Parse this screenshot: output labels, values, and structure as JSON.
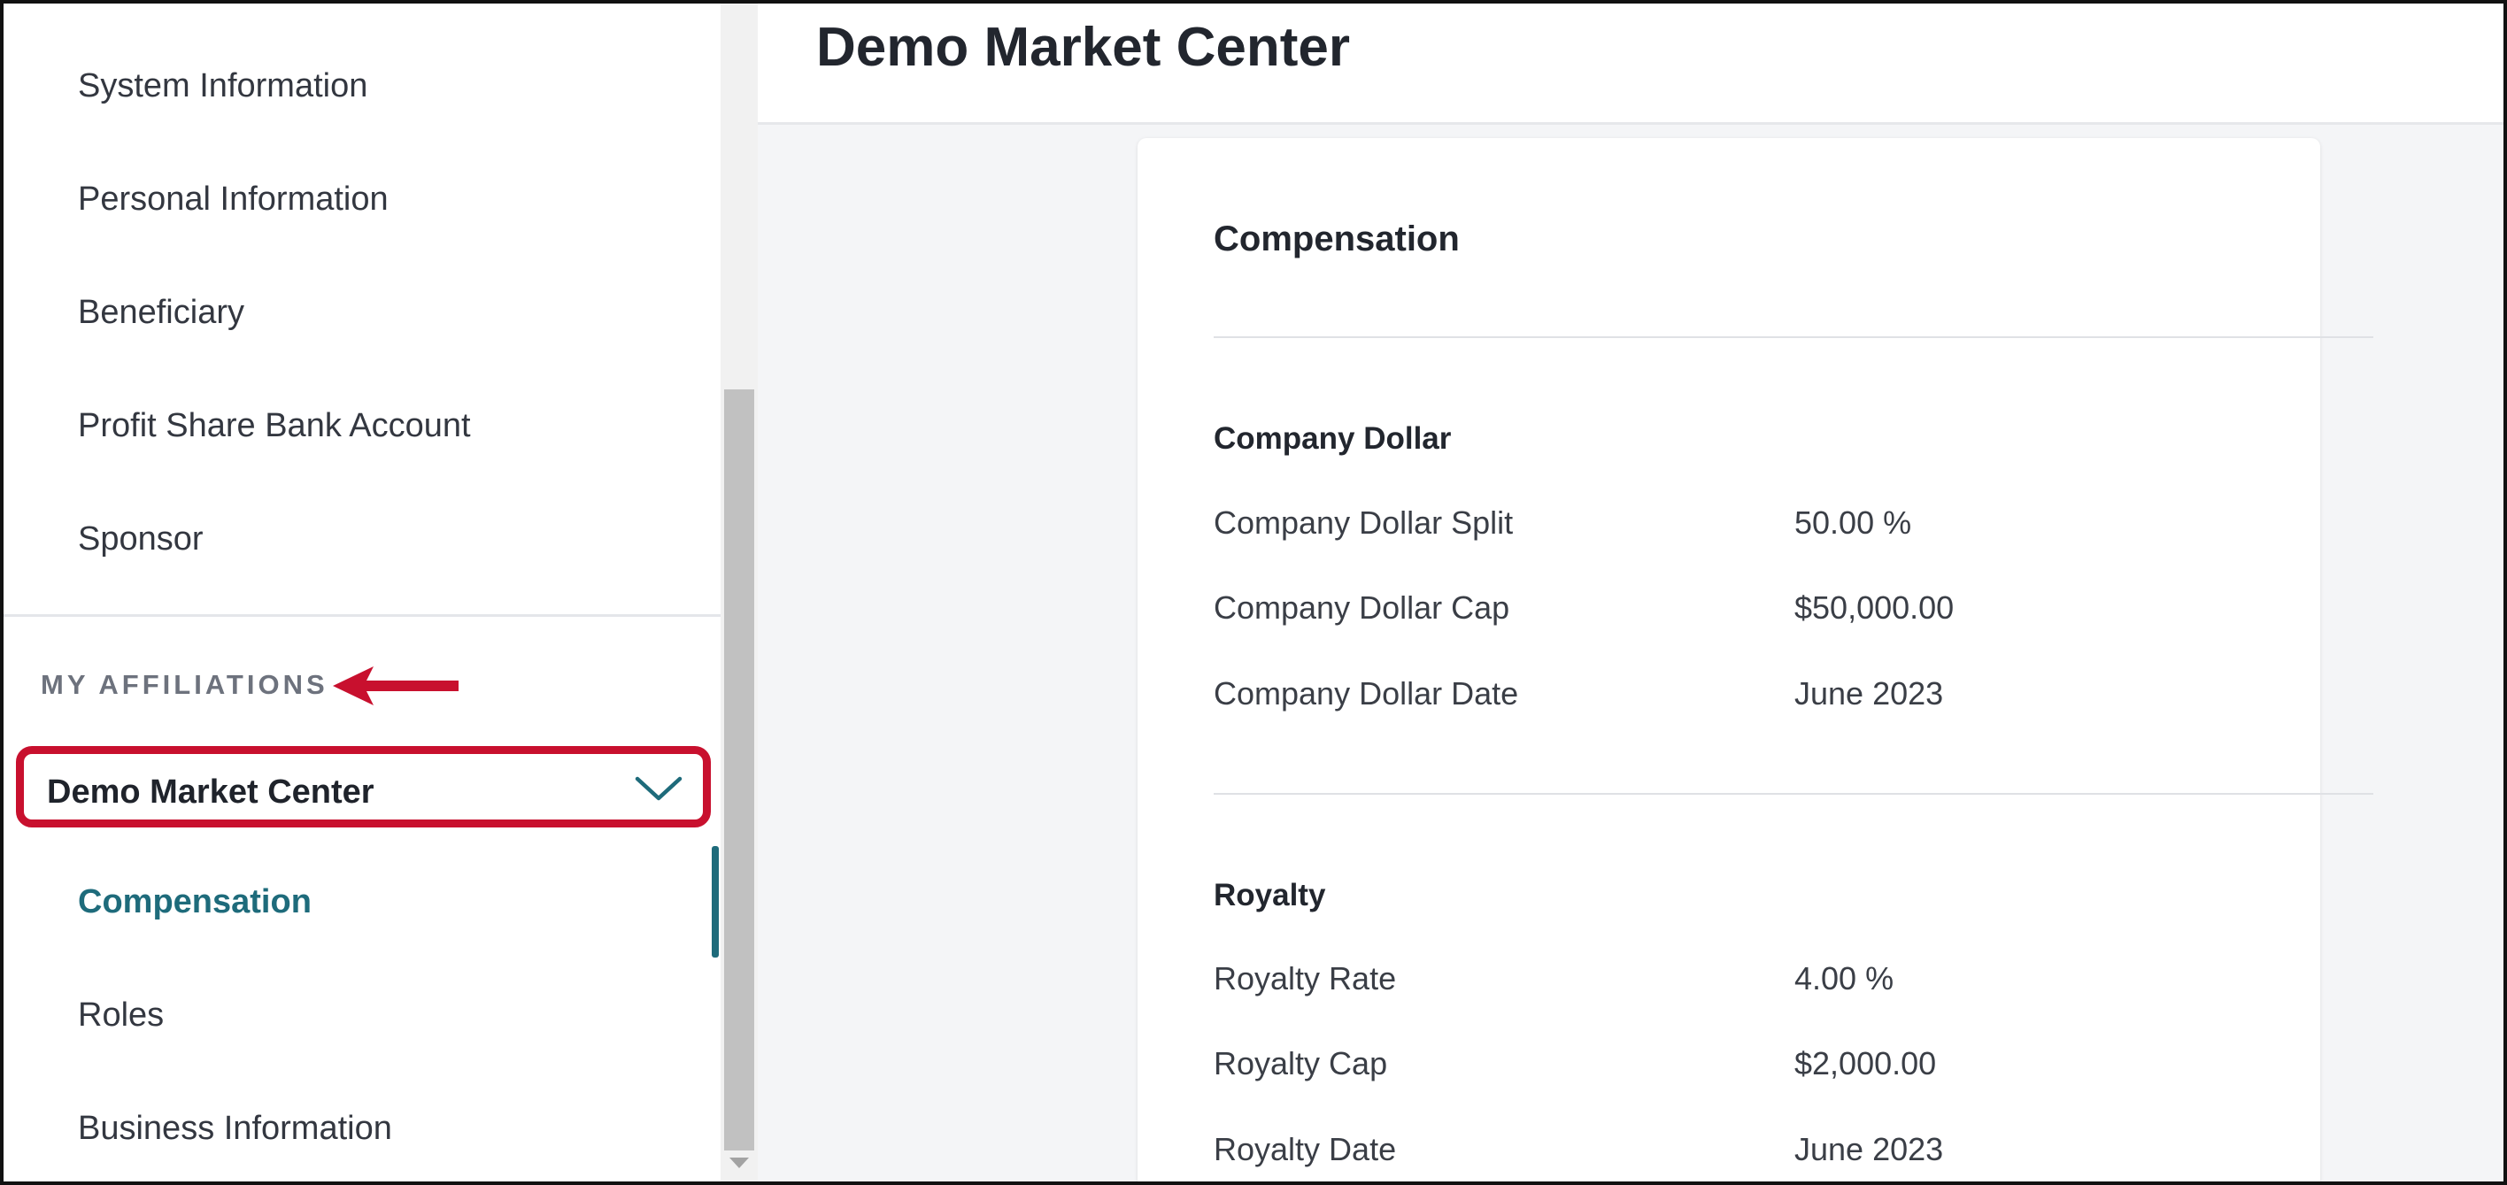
{
  "sidebar": {
    "items_top": [
      {
        "label": "System Information"
      },
      {
        "label": "Personal Information"
      },
      {
        "label": "Beneficiary"
      },
      {
        "label": "Profit Share Bank Account"
      },
      {
        "label": "Sponsor"
      }
    ],
    "section_label": "MY AFFILIATIONS",
    "affiliation": {
      "name": "Demo Market Center",
      "expanded": true
    },
    "sub_items": [
      {
        "label": "Compensation",
        "active": true
      },
      {
        "label": "Roles",
        "active": false
      },
      {
        "label": "Business Information",
        "active": false
      }
    ]
  },
  "main": {
    "page_title": "Demo Market Center",
    "card": {
      "title": "Compensation",
      "groups": [
        {
          "title": "Company Dollar",
          "rows": [
            {
              "label": "Company Dollar Split",
              "value": "50.00 %"
            },
            {
              "label": "Company Dollar Cap",
              "value": "$50,000.00"
            },
            {
              "label": "Company Dollar Date",
              "value": "June 2023"
            }
          ]
        },
        {
          "title": "Royalty",
          "rows": [
            {
              "label": "Royalty Rate",
              "value": "4.00 %"
            },
            {
              "label": "Royalty Cap",
              "value": "$2,000.00"
            },
            {
              "label": "Royalty Date",
              "value": "June 2023"
            }
          ]
        }
      ]
    }
  },
  "colors": {
    "accent_teal": "#1e6b7b",
    "annotation_red": "#c8102e"
  },
  "icons": {
    "chevron": "chevron-down-icon",
    "arrow": "arrow-left-annotation"
  }
}
